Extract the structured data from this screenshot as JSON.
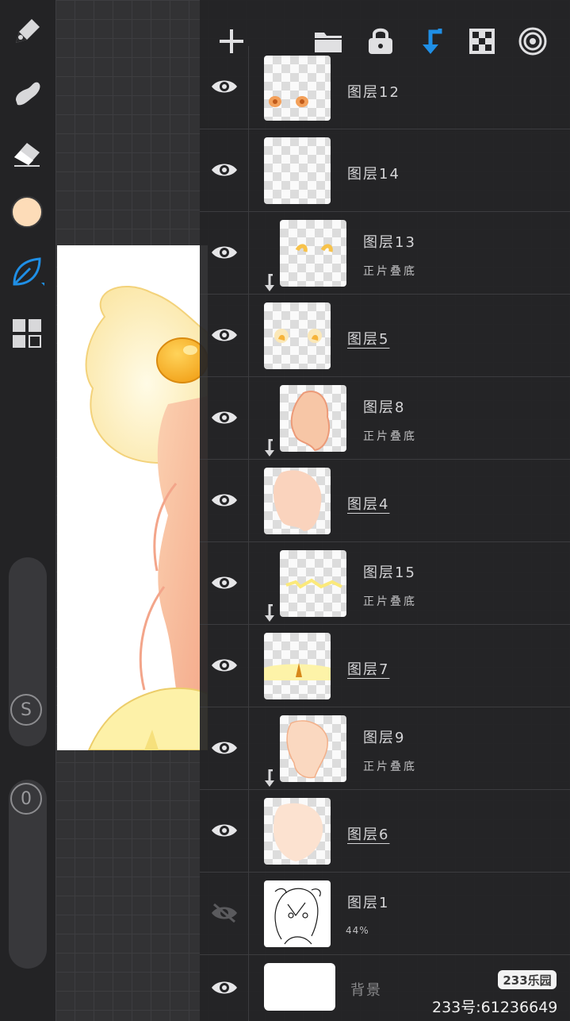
{
  "toolbar": {
    "tools": [
      "brush-icon",
      "smudge-icon",
      "eraser-icon",
      "color-swatch",
      "leaf-brush-icon",
      "gallery-icon"
    ],
    "current_color": "#fddcb8",
    "accent_color": "#1f8fe6",
    "size_label": "S",
    "opacity_label": "0"
  },
  "panel": {
    "header_icons": [
      "add-icon",
      "folder-icon",
      "lock-icon",
      "clip-arrow-icon",
      "checker-icon",
      "target-icon"
    ],
    "layers": [
      {
        "name": "图层12",
        "sub": "",
        "clipped": false,
        "visible": true,
        "active": false
      },
      {
        "name": "图层14",
        "sub": "",
        "clipped": false,
        "visible": true,
        "active": false
      },
      {
        "name": "图层13",
        "sub": "正片叠底",
        "clipped": true,
        "visible": true,
        "active": false
      },
      {
        "name": "图层5",
        "sub": "",
        "clipped": false,
        "visible": true,
        "active": true
      },
      {
        "name": "图层8",
        "sub": "正片叠底",
        "clipped": true,
        "visible": true,
        "active": false
      },
      {
        "name": "图层4",
        "sub": "",
        "clipped": false,
        "visible": true,
        "active": true
      },
      {
        "name": "图层15",
        "sub": "正片叠底",
        "clipped": true,
        "visible": true,
        "active": false
      },
      {
        "name": "图层7",
        "sub": "",
        "clipped": false,
        "visible": true,
        "active": true
      },
      {
        "name": "图层9",
        "sub": "正片叠底",
        "clipped": true,
        "visible": true,
        "active": false
      },
      {
        "name": "图层6",
        "sub": "",
        "clipped": false,
        "visible": true,
        "active": true
      },
      {
        "name": "图层1",
        "sub": "44%",
        "clipped": false,
        "visible": false,
        "active": false
      },
      {
        "name": "背景",
        "sub": "",
        "clipped": false,
        "visible": true,
        "active": false
      }
    ]
  },
  "watermark": {
    "logo": "233乐园",
    "id": "233号:61236649"
  }
}
